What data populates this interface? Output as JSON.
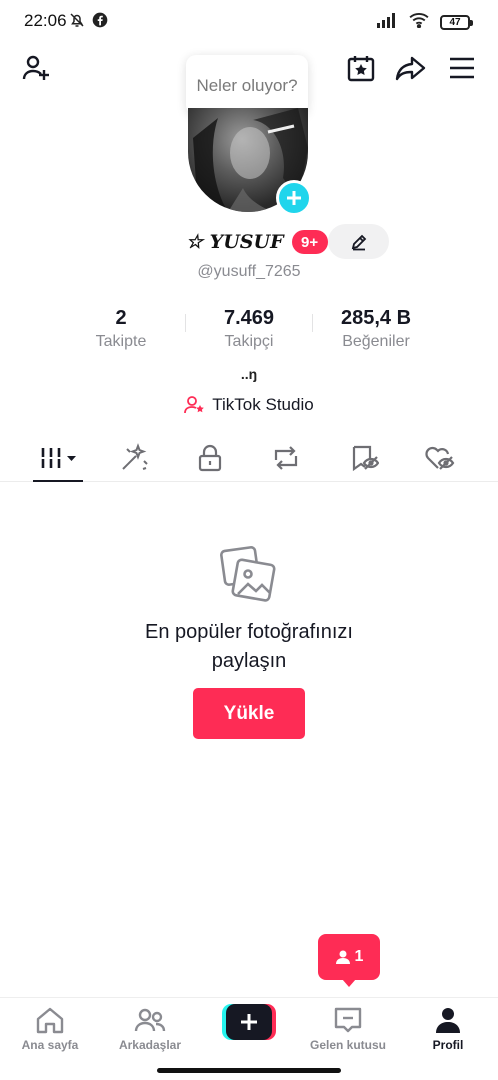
{
  "status_bar": {
    "time": "22:06",
    "battery": "47"
  },
  "header": {
    "tooltip": "Neler oluyor?"
  },
  "profile": {
    "display_name": "☆ YUSUF",
    "notification_count": "9+",
    "username": "@yusuff_7265",
    "stats": [
      {
        "value": "2",
        "label": "Takipte"
      },
      {
        "value": "7.469",
        "label": "Takipçi"
      },
      {
        "value": "285,4 B",
        "label": "Beğeniler"
      }
    ],
    "bio": "..ŋ",
    "studio_label": "TikTok Studio"
  },
  "empty_state": {
    "title": "En popüler fotoğrafınızı paylaşın",
    "button": "Yükle"
  },
  "follower_notification": {
    "count": "1"
  },
  "bottom_nav": [
    {
      "label": "Ana sayfa"
    },
    {
      "label": "Arkadaşlar"
    },
    {
      "label": "Gelen kutusu"
    },
    {
      "label": "Profil"
    }
  ],
  "colors": {
    "accent": "#fe2c55",
    "cyan": "#25f4ee",
    "avatar_add": "#20d5ec"
  }
}
